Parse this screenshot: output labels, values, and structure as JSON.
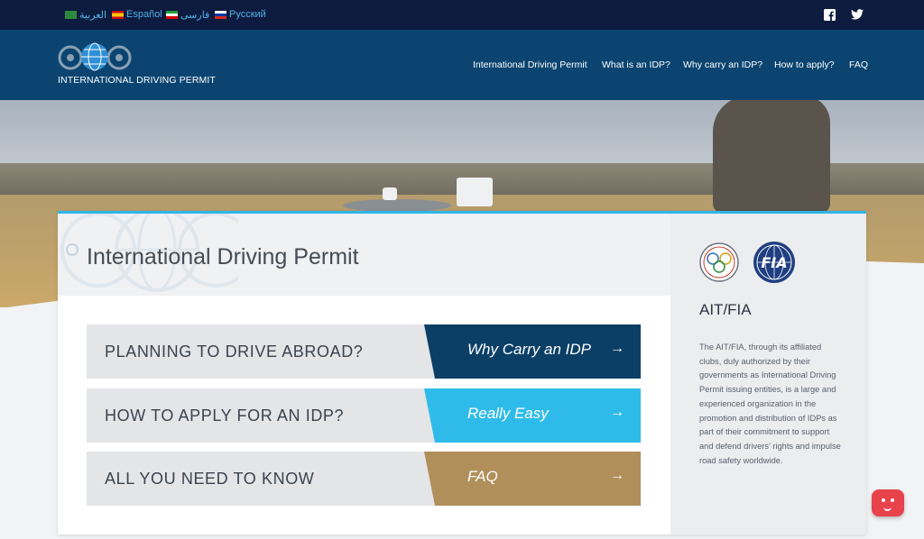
{
  "languages": [
    "العربية",
    "Español",
    "فارسی",
    "Русский"
  ],
  "social": {
    "facebook_icon": "facebook-icon",
    "twitter_icon": "twitter-icon"
  },
  "header": {
    "logo_text": "INTERNATIONAL DRIVING PERMIT",
    "nav": [
      "International Driving Permit",
      "What is an IDP?",
      "Why carry an IDP?",
      "How to apply?",
      "FAQ"
    ]
  },
  "main": {
    "title": "International Driving Permit",
    "rows": [
      {
        "label": "PLANNING TO DRIVE ABROAD?",
        "cta": "Why Carry an IDP",
        "color": "#0b3f66"
      },
      {
        "label": "HOW TO APPLY FOR AN IDP?",
        "cta": "Really Easy",
        "color": "#2fbbe9"
      },
      {
        "label": "ALL YOU NEED TO KNOW",
        "cta": "FAQ",
        "color": "#b18f5a"
      }
    ]
  },
  "panel": {
    "title": "AIT/FIA",
    "text": "The AIT/FIA, through its affiliated clubs, duly authorized by their governments as International Driving Permit issuing entities, is a large and experienced organization in the promotion and distribution of IDPs as part of their commitment to support and defend drivers’ rights and impulse road safety worldwide."
  },
  "colors": {
    "topbar": "#0d1b3e",
    "header": "#0b4470",
    "accent": "#2fb5e6"
  }
}
